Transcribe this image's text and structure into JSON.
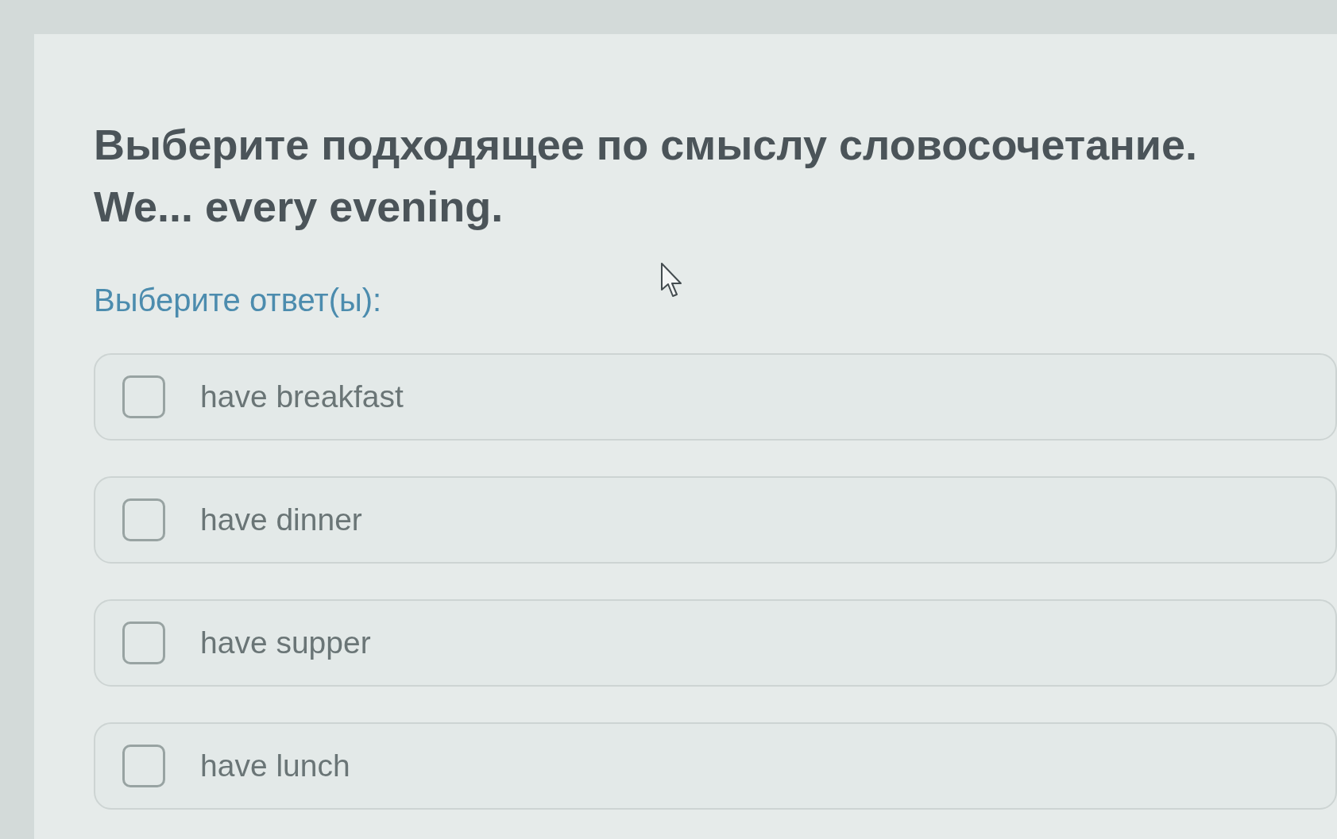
{
  "question": {
    "lines": [
      "Выберите подходящее по смыслу словосочетание.",
      "We... every evening."
    ]
  },
  "prompt": "Выберите ответ(ы):",
  "options": [
    {
      "label": "have breakfast",
      "checked": false
    },
    {
      "label": "have dinner",
      "checked": false
    },
    {
      "label": "have supper",
      "checked": false
    },
    {
      "label": "have lunch",
      "checked": false
    }
  ]
}
